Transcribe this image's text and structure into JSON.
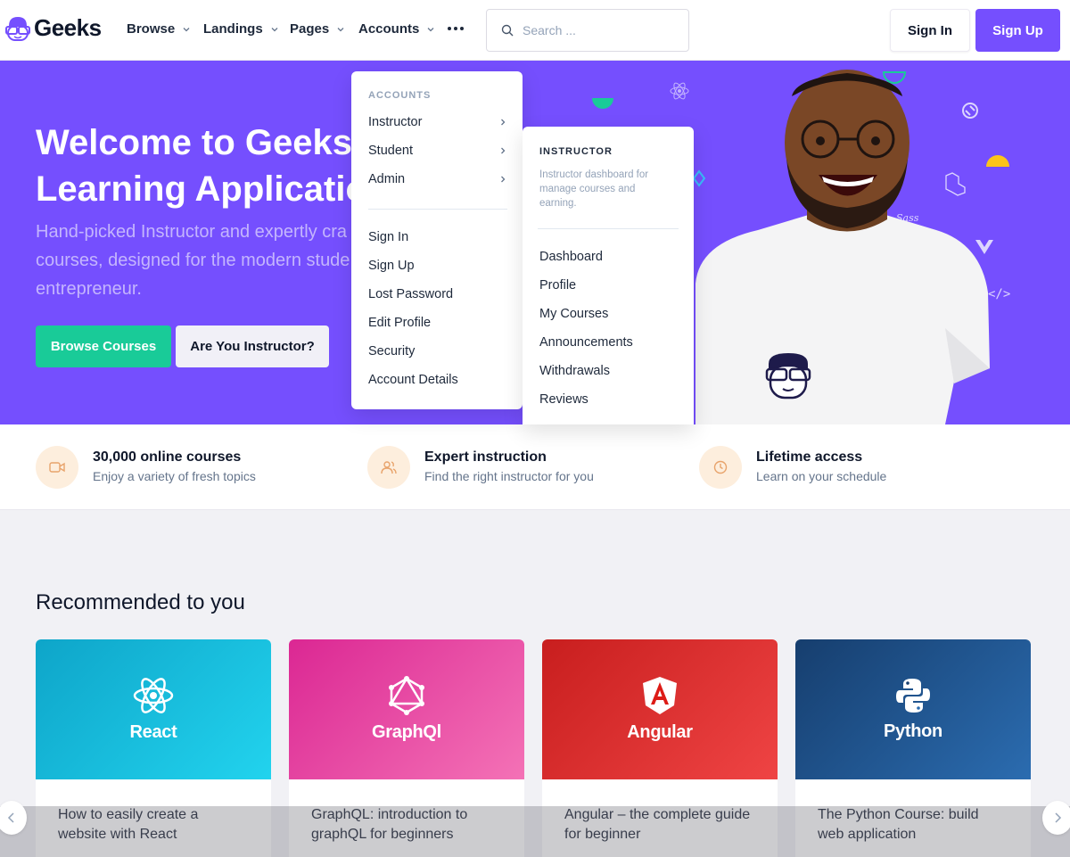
{
  "brand": {
    "name": "Geeks"
  },
  "nav": {
    "items": [
      {
        "label": "Browse"
      },
      {
        "label": "Landings"
      },
      {
        "label": "Pages"
      },
      {
        "label": "Accounts"
      }
    ],
    "search_placeholder": "Search ...",
    "signin_label": "Sign In",
    "signup_label": "Sign Up"
  },
  "hero": {
    "title_line1": "Welcome to Geeks",
    "title_line2": "Learning Applicatio",
    "subtitle": "Hand-picked Instructor and expertly cra courses, designed for the modern stude entrepreneur.",
    "subtitle_line1": "Hand-picked Instructor and expertly cra",
    "subtitle_line2": "courses, designed for the modern stude",
    "subtitle_line3": "entrepreneur.",
    "primary_button": "Browse Courses",
    "secondary_button": "Are You Instructor?"
  },
  "accounts_menu": {
    "header": "ACCOUNTS",
    "groups": [
      {
        "label": "Instructor"
      },
      {
        "label": "Student"
      },
      {
        "label": "Admin"
      }
    ],
    "links": [
      {
        "label": "Sign In"
      },
      {
        "label": "Sign Up"
      },
      {
        "label": "Lost Password"
      },
      {
        "label": "Edit Profile"
      },
      {
        "label": "Security"
      },
      {
        "label": "Account Details"
      }
    ]
  },
  "instructor_menu": {
    "header": "INSTRUCTOR",
    "description": "Instructor dashboard for manage courses and earning.",
    "items": [
      {
        "label": "Dashboard"
      },
      {
        "label": "Profile"
      },
      {
        "label": "My Courses"
      },
      {
        "label": "Announcements"
      },
      {
        "label": "Withdrawals"
      },
      {
        "label": "Reviews"
      }
    ]
  },
  "features": [
    {
      "title": "30,000 online courses",
      "desc": "Enjoy a variety of fresh topics",
      "icon": "video-icon"
    },
    {
      "title": "Expert instruction",
      "desc": "Find the right instructor for you",
      "icon": "users-icon"
    },
    {
      "title": "Lifetime access",
      "desc": "Learn on your schedule",
      "icon": "clock-icon"
    }
  ],
  "recommended": {
    "title": "Recommended to you",
    "courses": [
      {
        "caption": "React",
        "title": "How to easily create a website with React",
        "color": "#0fb5dd"
      },
      {
        "caption": "GraphQl",
        "title": "GraphQL: introduction to graphQL for beginners",
        "color": "#e535ab"
      },
      {
        "caption": "Angular",
        "title": "Angular – the complete guide for beginner",
        "color": "#dd1b16"
      },
      {
        "caption": "Python",
        "title": "The Python Course: build web application",
        "color": "#1c4b82"
      }
    ]
  },
  "colors": {
    "primary": "#754ffe",
    "success": "#19cb98",
    "feature_bg": "#fdeedd"
  }
}
